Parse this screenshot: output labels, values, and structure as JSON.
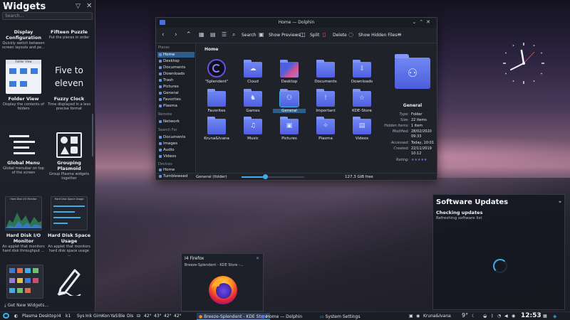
{
  "colors": {
    "accent": "#3daee9",
    "folder": "#5b6fe8",
    "panel": "#1c1e25",
    "selection": "#2d5d8a"
  },
  "widgets_panel": {
    "title": "Widgets",
    "search_placeholder": "Search...",
    "footer": "Get New Widgets...",
    "items": [
      {
        "name": "Display Configuration",
        "desc": "Quickly switch between screen layouts and pe..."
      },
      {
        "name": "Fifteen Puzzle",
        "desc": "Put the pieces in order"
      },
      {
        "name": "Folder View",
        "desc": "Display the contents of folders",
        "thumb_title": "Folder View"
      },
      {
        "name": "Fuzzy Clock",
        "desc": "Time displayed in a less precise format",
        "thumb_text": "Five to eleven"
      },
      {
        "name": "Global Menu",
        "desc": "Global menubar on top of the screen"
      },
      {
        "name": "Grouping Plasmoid",
        "desc": "Group Plasma widgets together"
      },
      {
        "name": "Hard Disk I/O Monitor",
        "desc": "An applet that monitors hard disk throughput ...",
        "thumb_title": "Hard Disk I/O Monitor"
      },
      {
        "name": "Hard Disk Space Usage",
        "desc": "An applet that monitors hard disk space usage ...",
        "thumb_title": "Hard Disk Space Usage"
      }
    ]
  },
  "dolphin": {
    "window_title": "Home — Dolphin",
    "toolbar": {
      "search": "Search",
      "show_previews": "Show Previews",
      "split": "Split",
      "delete": "Delete",
      "show_hidden": "Show Hidden Files"
    },
    "sections": {
      "places": "Places",
      "remote": "Remote",
      "search_for": "Search For",
      "devices": "Devices"
    },
    "places": [
      "Home",
      "Desktop",
      "Documents",
      "Downloads",
      "Trash",
      "Pictures",
      "General",
      "Favorites",
      "Plasma"
    ],
    "remote": [
      "Network"
    ],
    "search_for": [
      "Documents",
      "Images",
      "Audio",
      "Videos"
    ],
    "devices": [
      "Home",
      "Tumbleweed"
    ],
    "breadcrumb": "Home",
    "files": [
      {
        "name": "\"Splendent\"",
        "glyph": ""
      },
      {
        "name": "Cloud",
        "glyph": "☁"
      },
      {
        "name": "Desktop",
        "glyph": ""
      },
      {
        "name": "Documents",
        "glyph": ""
      },
      {
        "name": "Downloads",
        "glyph": "⇩"
      },
      {
        "name": "Favorites",
        "glyph": ""
      },
      {
        "name": "Games",
        "glyph": "♞"
      },
      {
        "name": "General",
        "glyph": "⚇"
      },
      {
        "name": "Important",
        "glyph": "!"
      },
      {
        "name": "KDE-Store",
        "glyph": "☆"
      },
      {
        "name": "Kruna&Ivana",
        "glyph": ""
      },
      {
        "name": "Music",
        "glyph": "♫"
      },
      {
        "name": "Pictures",
        "glyph": "▣"
      },
      {
        "name": "Plasma",
        "glyph": "✧"
      },
      {
        "name": "Videos",
        "glyph": "▤"
      }
    ],
    "info": {
      "title": "General",
      "rows": [
        {
          "k": "Type:",
          "v": "Folder"
        },
        {
          "k": "Size:",
          "v": "22 items"
        },
        {
          "k": "Hidden items:",
          "v": "1 item"
        },
        {
          "k": "Modified:",
          "v": "28/02/2020"
        },
        {
          "k": "",
          "v": "09:33"
        },
        {
          "k": "Accessed:",
          "v": "Today, 10:01"
        },
        {
          "k": "Created:",
          "v": "22/11/2019"
        },
        {
          "k": "",
          "v": "10:12"
        },
        {
          "k": "Rating:",
          "v": "★★★★★"
        }
      ]
    },
    "status_left": "General (folder)",
    "status_right": "127.3 GiB free",
    "zoom_fraction": 0.38
  },
  "updates": {
    "title": "Software Updates",
    "checking": "Checking updates",
    "sub": "Refreshing software list"
  },
  "firefox": {
    "title": "Firefox",
    "subtitle": "Breeze-Splendent - KDE Store -..."
  },
  "taskbar": {
    "activity": "Plasma Desktop",
    "desktops": [
      "I4",
      "k1"
    ],
    "pager": [
      "Sys",
      "Ink",
      "Gim",
      "Kon",
      "YaS",
      "Ble",
      "Dis"
    ],
    "temps": [
      "42°",
      "43°",
      "42°",
      "42°"
    ],
    "tasks": [
      "Breeze-Splendent - KDE Store",
      "Home — Dolphin",
      "System Settings"
    ],
    "user": "Kruna&Ivana",
    "weather": "9°",
    "clock": "12:53"
  }
}
